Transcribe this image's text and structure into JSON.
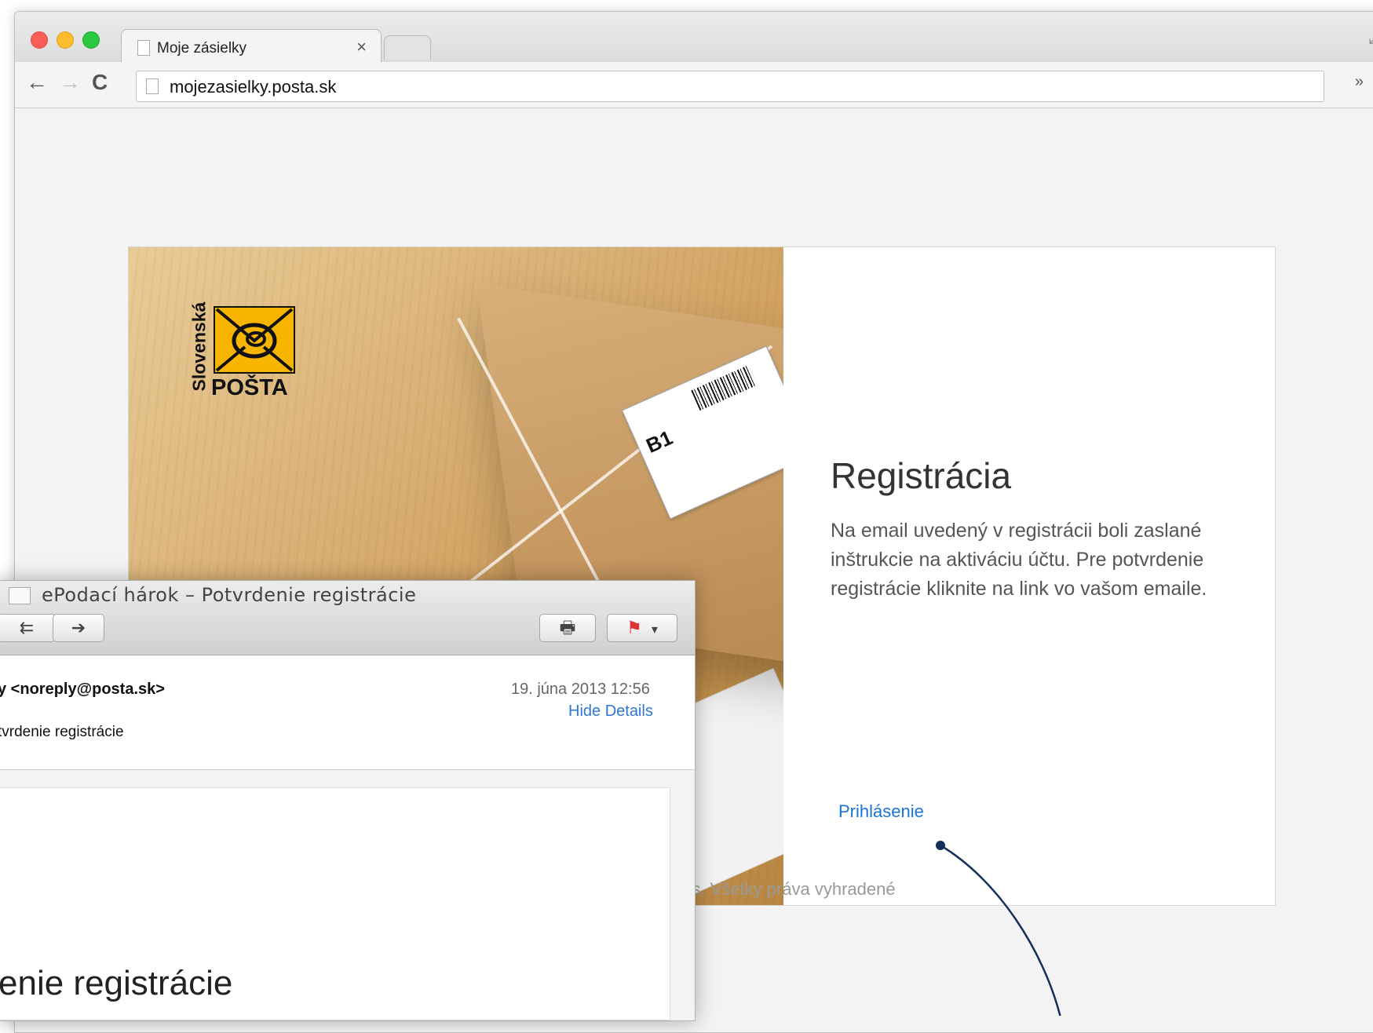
{
  "browser": {
    "tab_title": "Moje zásielky",
    "tab_close": "×",
    "url": "mojezasielky.posta.sk",
    "nav": {
      "back": "←",
      "forward": "→",
      "reload": "C"
    },
    "overflow": "»",
    "menu": "≡"
  },
  "logo": {
    "vertical_text": "Slovenská",
    "name": "POŠTA"
  },
  "hero_label": {
    "text": "B1"
  },
  "registration": {
    "title": "Registrácia",
    "message": "Na email uvedený v registrácii boli zaslané inštrukcie na aktiváciu účtu. Pre potvrdenie registrácie kliknite na link vo vašom emaile.",
    "login_link": "Prihlásenie"
  },
  "footer": {
    "text": "a.s. Všetky práva vyhradené"
  },
  "mail": {
    "window_title": "ePodací hárok – Potvrdenie registrácie",
    "from": "y <noreply@posta.sk>",
    "date": "19. júna 2013 12:56",
    "hide_details": "Hide Details",
    "subject_line": "tvrdenie registrácie",
    "body_heading": "enie registrácie",
    "buttons": {
      "reply": "⇇",
      "forward": "➔",
      "print": "🖶",
      "flag": "⚑",
      "flag_menu": "▾"
    }
  },
  "colors": {
    "link": "#1b73d8",
    "logo_yellow": "#f7b500",
    "annotation_line": "#12305a"
  }
}
